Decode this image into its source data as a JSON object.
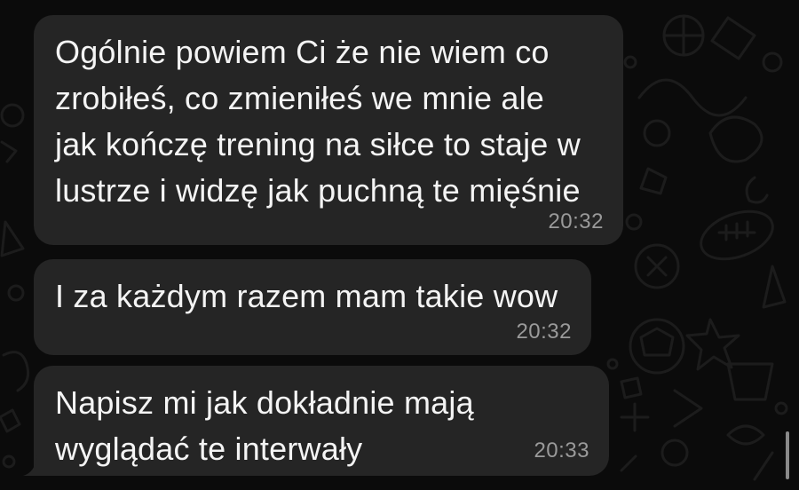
{
  "messages": [
    {
      "text": "Ogólnie powiem Ci że nie wiem co\nzrobiłeś, co zmieniłeś we mnie ale\njak kończę trening na siłce to staje w\nlustrze i widzę jak puchną te mięśnie",
      "time": "20:32"
    },
    {
      "text": "I za każdym razem mam takie wow",
      "time": "20:32"
    },
    {
      "text": "Napisz mi jak dokładnie mają\nwyglądać te interwały",
      "time": "20:33"
    }
  ],
  "colors": {
    "background": "#0b0b0b",
    "bubble": "#252525",
    "text": "#f4f4f4",
    "time": "#9a9a9a"
  }
}
